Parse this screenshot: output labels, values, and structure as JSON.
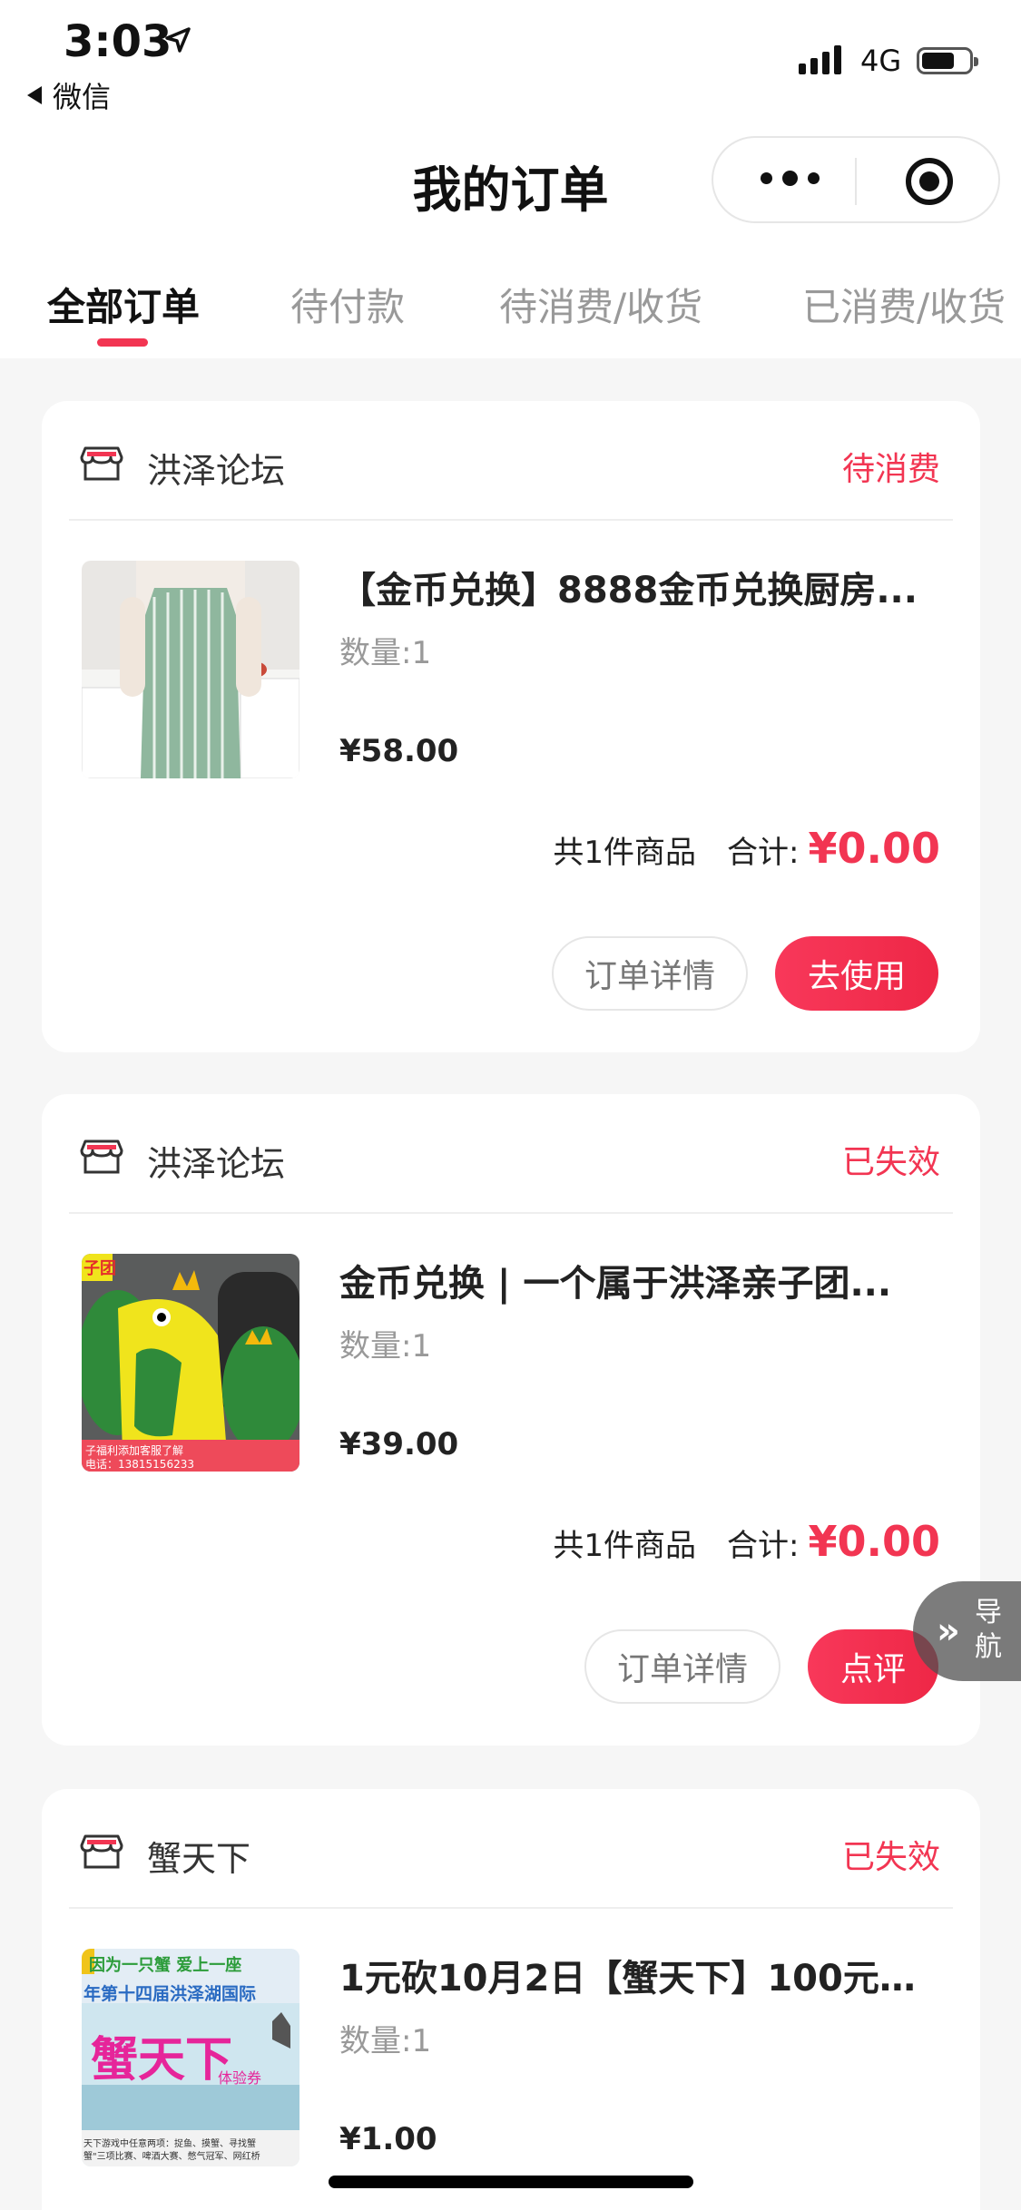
{
  "status_bar": {
    "time": "3:03",
    "back_label": "微信",
    "network": "4G",
    "signal_icon": "signal-bars-icon",
    "battery_icon": "battery-icon",
    "battery_level": 0.7
  },
  "header": {
    "title": "我的订单",
    "more_icon": "more-dots-icon",
    "close_icon": "target-circle-icon"
  },
  "tabs": [
    {
      "label": "全部订单",
      "active": true
    },
    {
      "label": "待付款",
      "active": false
    },
    {
      "label": "待消费/收货",
      "active": false
    },
    {
      "label": "已消费/收货",
      "active": false
    }
  ],
  "accent_color": "#f23552",
  "orders": [
    {
      "shop": "洪泽论坛",
      "status": "待消费",
      "product_name": "【金币兑换】8888金币兑换厨房...",
      "quantity": "数量:1",
      "price": "¥58.00",
      "count_text": "共1件商品",
      "total_label": "合计:",
      "total": "¥0.00",
      "btn_detail": "订单详情",
      "btn_action": "去使用"
    },
    {
      "shop": "洪泽论坛",
      "status": "已失效",
      "product_name": "金币兑换 | 一个属于洪泽亲子团...",
      "quantity": "数量:1",
      "price": "¥39.00",
      "count_text": "共1件商品",
      "total_label": "合计:",
      "total": "¥0.00",
      "btn_detail": "订单详情",
      "btn_action": "点评",
      "thumb_text_top": "子团",
      "thumb_text_bottom_1": "子福利添加客服了解",
      "thumb_text_bottom_2": "电话：13815156233"
    },
    {
      "shop": "蟹天下",
      "status": "已失效",
      "product_name": "1元砍10月2日【蟹天下】100元双...",
      "quantity": "数量:1",
      "price": "¥1.00",
      "thumb_text_1": "因为一只蟹  爱上一座",
      "thumb_text_2": "年第十四届洪泽湖国际",
      "thumb_text_3": "蟹天下",
      "thumb_text_4": "体验券",
      "thumb_text_5": "天下游戏中任意两项：捉鱼、摸蟹、寻找蟹",
      "thumb_text_6": "蟹\"三项比赛、啤酒大赛、憋气冠军、网红桥"
    }
  ],
  "nav_float": {
    "label": "导航",
    "icon": "double-chevron-icon"
  }
}
